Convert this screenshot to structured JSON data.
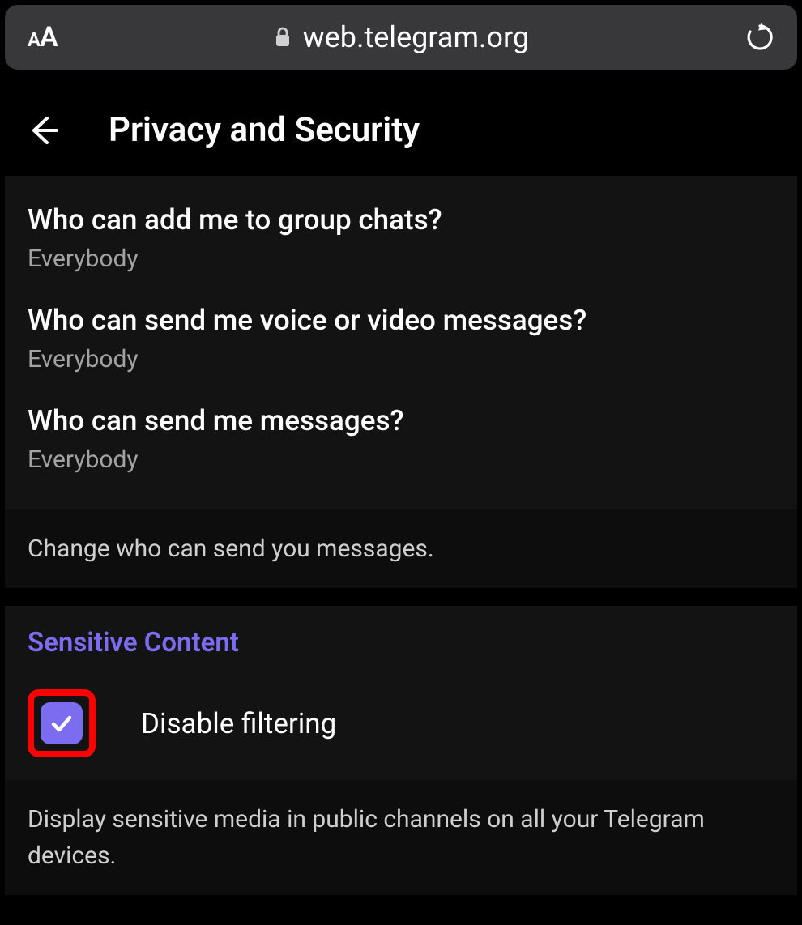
{
  "browser": {
    "url": "web.telegram.org"
  },
  "header": {
    "title": "Privacy and Security"
  },
  "settings": [
    {
      "title": "Who can add me to group chats?",
      "value": "Everybody"
    },
    {
      "title": "Who can send me voice or video messages?",
      "value": "Everybody"
    },
    {
      "title": "Who can send me messages?",
      "value": "Everybody"
    }
  ],
  "settings_footer": "Change who can send you messages.",
  "section": {
    "heading": "Sensitive Content",
    "toggle_label": "Disable filtering",
    "toggle_checked": true,
    "footer": "Display sensitive media in public channels on all your Telegram devices."
  },
  "colors": {
    "accent": "#7b6cf0",
    "highlight": "#ff0000"
  }
}
